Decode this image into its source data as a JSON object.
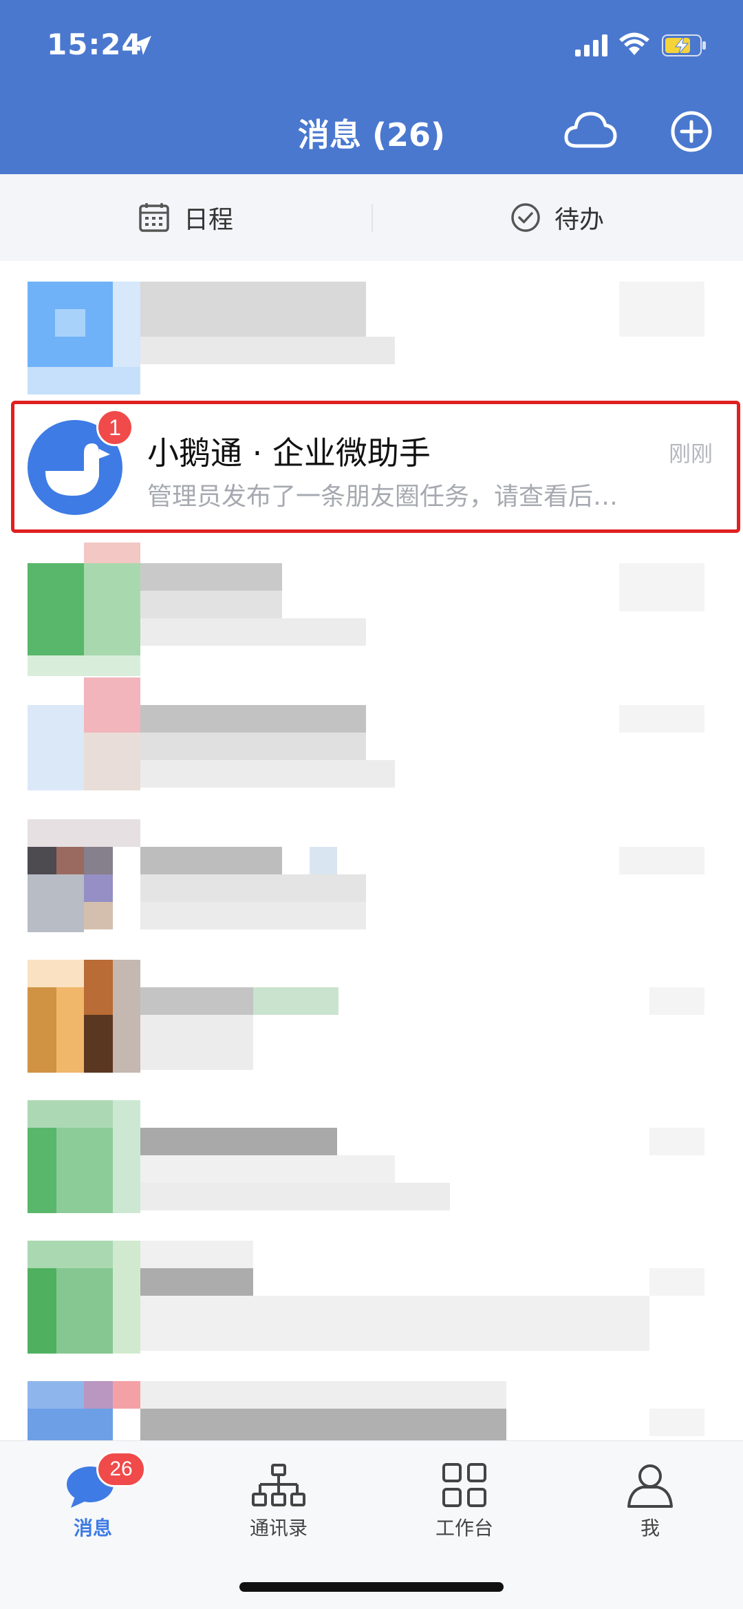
{
  "status_bar": {
    "time": "15:24"
  },
  "header": {
    "title": "消息 (26)"
  },
  "segments": {
    "schedule": "日程",
    "todo": "待办"
  },
  "highlighted_chat": {
    "name": "小鹅通 · 企业微助手",
    "preview": "管理员发布了一条朋友圈任务，请查看后…",
    "time": "刚刚",
    "unread": "1"
  },
  "tabs": [
    {
      "label": "消息",
      "badge": "26"
    },
    {
      "label": "通讯录"
    },
    {
      "label": "工作台"
    },
    {
      "label": "我"
    }
  ],
  "colors": {
    "brand_blue": "#4a78cf",
    "accent_blue": "#3e7be5",
    "badge_red": "#f04a4a",
    "highlight_red": "#e02020"
  }
}
